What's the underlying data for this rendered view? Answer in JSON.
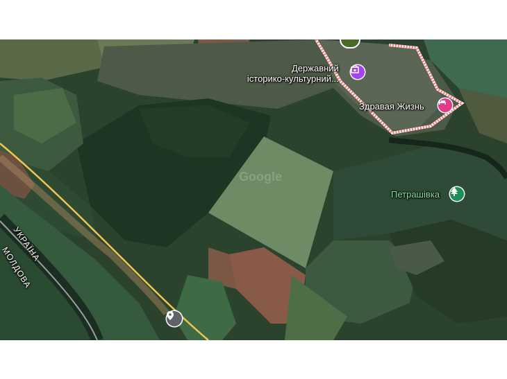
{
  "map": {
    "type": "satellite",
    "watermark": "Google",
    "places": {
      "museum": {
        "line1": "Державний",
        "line2": "історико-культурний...",
        "icon": "museum-icon",
        "color": "#a142f4"
      },
      "hotel": {
        "name": "Здравая Жизнь",
        "icon": "bed-icon",
        "color": "#e8388a"
      },
      "park": {
        "name": "Петрашівка",
        "icon": "tree-icon",
        "color": "#1e8e5a"
      }
    },
    "border_labels": {
      "ukraine": "УКРАЇНА",
      "moldova": "МОЛДОВА"
    },
    "location_pin": {
      "icon": "location-pin-icon"
    },
    "colors": {
      "road": "#f2c550",
      "boundary": "#ff7a7a"
    }
  }
}
